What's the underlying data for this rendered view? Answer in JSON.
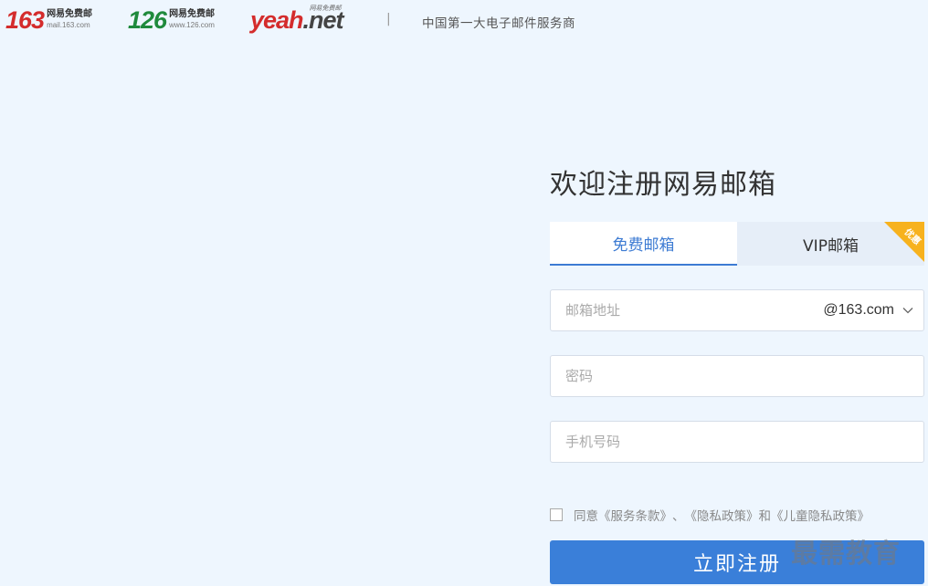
{
  "header": {
    "logos": [
      {
        "num": "163",
        "cn": "网易免费邮",
        "url": "mail.163.com"
      },
      {
        "num": "126",
        "cn": "网易免费邮",
        "url": "www.126.com"
      }
    ],
    "yeah": {
      "word": "yeah",
      "net": ".net",
      "sub": "网易免费邮"
    },
    "separator": "|",
    "slogan": "中国第一大电子邮件服务商"
  },
  "form": {
    "title": "欢迎注册网易邮箱",
    "tabs": [
      {
        "label": "免费邮箱",
        "active": true
      },
      {
        "label": "VIP邮箱",
        "active": false,
        "badge": "优惠"
      }
    ],
    "email": {
      "placeholder": "邮箱地址",
      "domain": "@163.com"
    },
    "password": {
      "placeholder": "密码"
    },
    "phone": {
      "placeholder": "手机号码"
    },
    "agreement": {
      "prefix": "同意",
      "terms": "《服务条款》",
      "sep1": "、",
      "privacy": "《隐私政策》",
      "and": "和",
      "child_privacy": "《儿童隐私政策》"
    },
    "submit_label": "立即注册"
  },
  "watermark": "最需教育",
  "colors": {
    "background": "#eef6fe",
    "accent": "#3a7fd9",
    "brand_red": "#d42c2c",
    "brand_green": "#1f8a3c",
    "badge": "#f7b21e"
  },
  "icons": {
    "domain_dropdown": "chevron-down-icon"
  }
}
